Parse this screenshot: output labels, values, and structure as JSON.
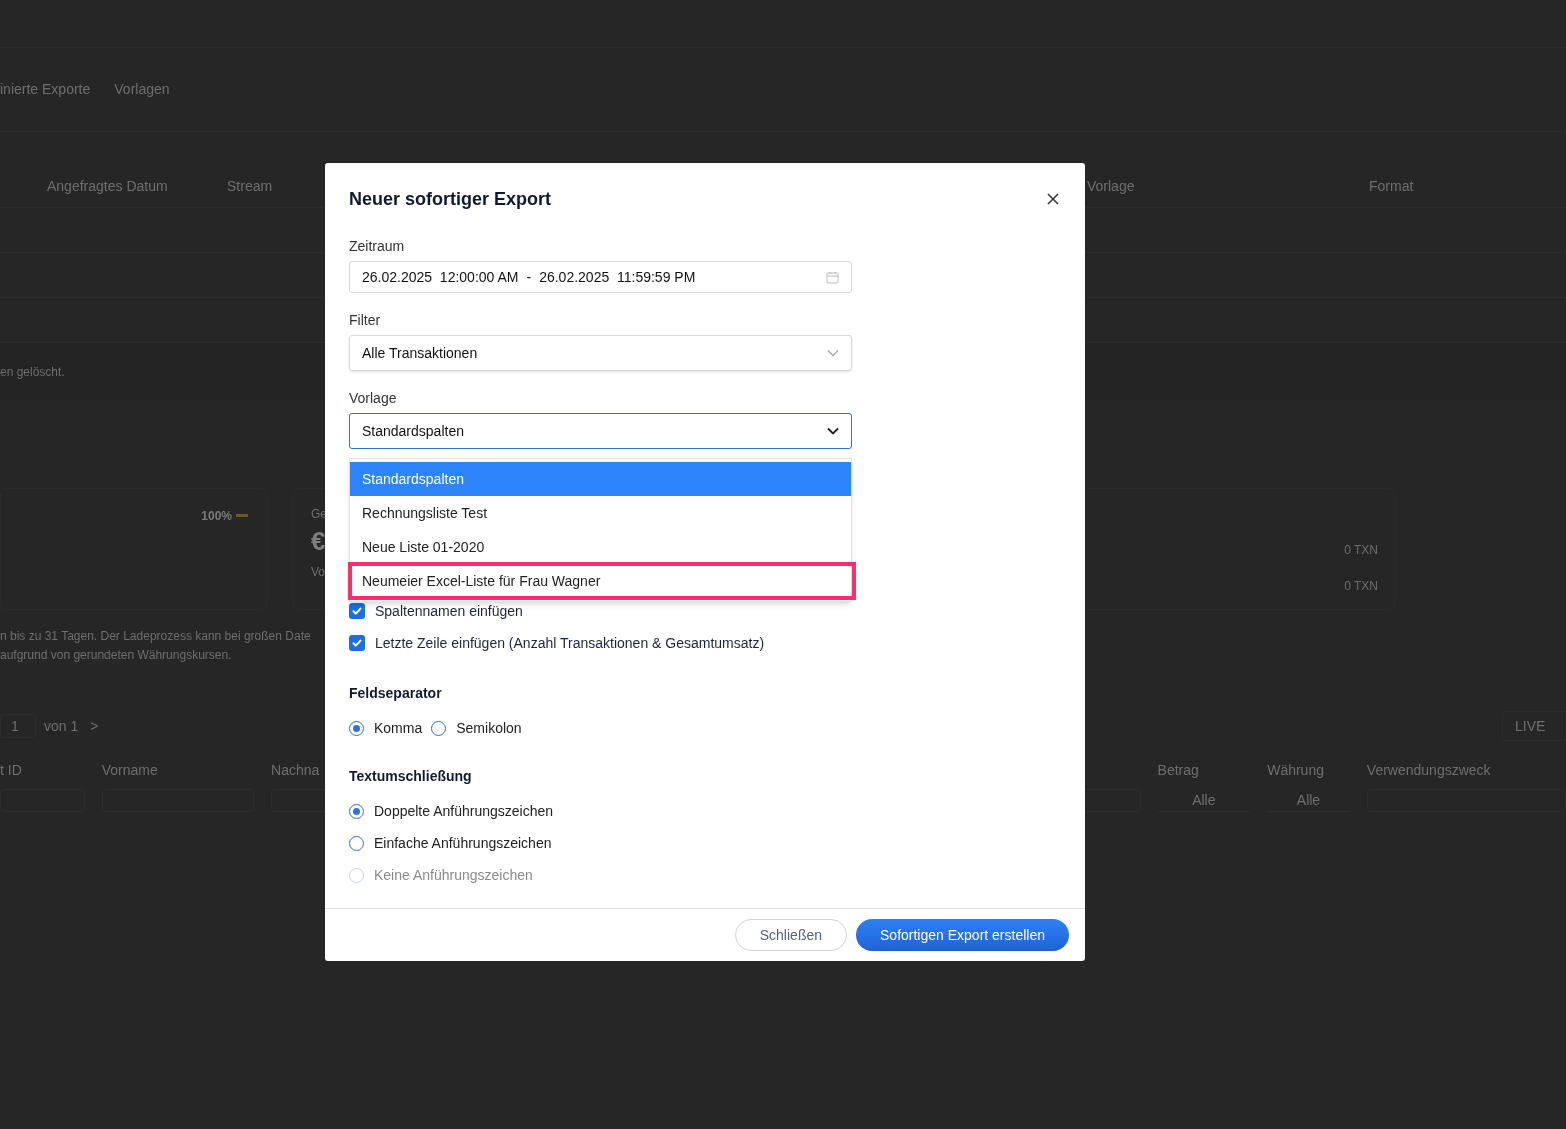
{
  "background": {
    "tabs": [
      "inierte Exporte",
      "Vorlagen"
    ],
    "exports_table": {
      "columns": [
        "Angefragtes Datum",
        "Stream",
        "Vorlage",
        "Format"
      ]
    },
    "notice": "en gelöscht.",
    "stats": {
      "percent": "100%",
      "card_label": "Ge",
      "card_value": "€",
      "card_sublabel": "Vo",
      "counts": [
        "0 TXN",
        "0 TXN"
      ]
    },
    "info_lines": [
      "n bis zu 31 Tagen. Der Ladeprozess kann bei großen Date",
      "aufgrund von gerundeten Währungskursen."
    ],
    "pagination": {
      "page": "1",
      "total": "von 1",
      "next": ">"
    },
    "mode_badge": "LIVE",
    "filter_columns": [
      {
        "label": "t ID",
        "kind": "input"
      },
      {
        "label": "Vorname",
        "kind": "input"
      },
      {
        "label": "Nachna",
        "kind": "input"
      },
      {
        "kind": "input"
      },
      {
        "label": "Betrag",
        "kind": "select",
        "value": "Alle"
      },
      {
        "label": "Währung",
        "kind": "select",
        "value": "Alle"
      },
      {
        "label": "Verwendungszweck",
        "kind": "input"
      }
    ]
  },
  "dialog": {
    "title": "Neuer sofortiger Export",
    "period": {
      "label": "Zeitraum",
      "start": "26.02.2025  12:00:00 AM",
      "separator": "-",
      "end": "26.02.2025  11:59:59 PM"
    },
    "filter": {
      "label": "Filter",
      "value": "Alle Transaktionen"
    },
    "template": {
      "label": "Vorlage",
      "value": "Standardspalten",
      "expanded": true,
      "options": [
        {
          "label": "Standardspalten",
          "selected": true,
          "highlighted": false
        },
        {
          "label": "Rechnungsliste Test",
          "selected": false,
          "highlighted": false
        },
        {
          "label": "Neue Liste 01-2020",
          "selected": false,
          "highlighted": false
        },
        {
          "label": "Neumeier Excel-Liste für Frau Wagner",
          "selected": false,
          "highlighted": true
        }
      ]
    },
    "checkboxes": [
      {
        "label": "Spaltennamen einfügen",
        "checked": true
      },
      {
        "label": "Letzte Zeile einfügen (Anzahl Transaktionen & Gesamtumsatz)",
        "checked": true
      }
    ],
    "separator": {
      "title": "Feldseparator",
      "options": [
        {
          "label": "Komma",
          "selected": true,
          "disabled": false
        },
        {
          "label": "Semikolon",
          "selected": false,
          "disabled": false
        }
      ]
    },
    "quoting": {
      "title": "Textumschließung",
      "options": [
        {
          "label": "Doppelte Anführungszeichen",
          "selected": true,
          "disabled": false
        },
        {
          "label": "Einfache Anführungszeichen",
          "selected": false,
          "disabled": false
        },
        {
          "label": "Keine Anführungszeichen",
          "selected": false,
          "disabled": true
        }
      ]
    },
    "buttons": [
      {
        "label": "Schließen",
        "kind": "secondary"
      },
      {
        "label": "Sofortigen Export erstellen",
        "kind": "primary"
      }
    ]
  }
}
